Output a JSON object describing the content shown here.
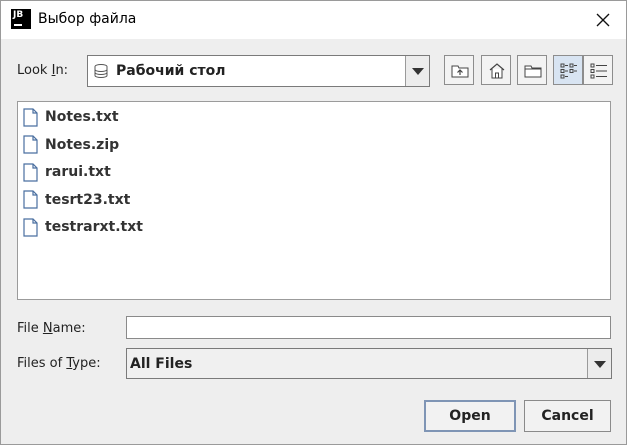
{
  "window": {
    "title": "Выбор файла",
    "app_icon_text": "JB"
  },
  "look_in": {
    "label_prefix": "Look ",
    "label_mnemonic": "I",
    "label_suffix": "n:",
    "value": "Рабочий стол"
  },
  "toolbar": {
    "buttons": [
      "up-one-level",
      "home",
      "new-folder",
      "list-view",
      "details-view"
    ],
    "selected": "list-view"
  },
  "files": [
    {
      "name": "Notes.txt"
    },
    {
      "name": "Notes.zip"
    },
    {
      "name": "rarui.txt"
    },
    {
      "name": "tesrt23.txt"
    },
    {
      "name": "testrarxt.txt"
    }
  ],
  "file_name": {
    "label_prefix": "File ",
    "label_mnemonic": "N",
    "label_suffix": "ame:",
    "value": ""
  },
  "file_type": {
    "label_prefix": "Files of ",
    "label_mnemonic": "T",
    "label_suffix": "ype:",
    "value": "All Files"
  },
  "buttons": {
    "open": "Open",
    "cancel": "Cancel"
  }
}
